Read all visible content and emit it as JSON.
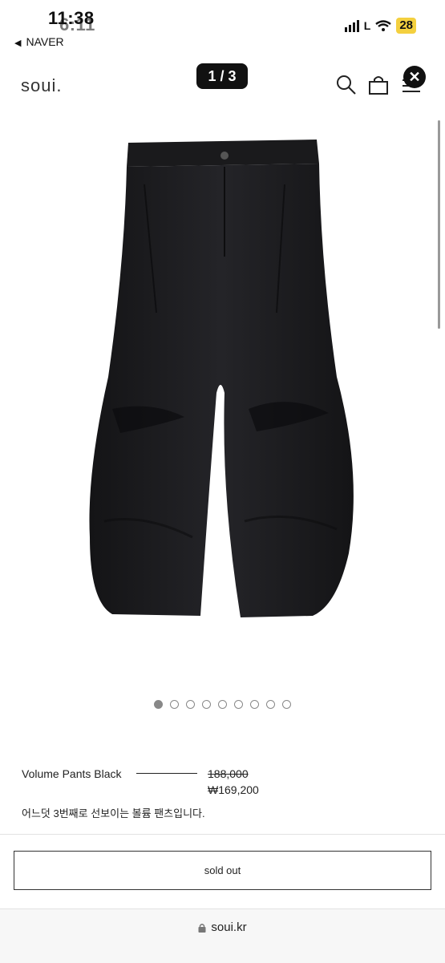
{
  "status": {
    "time": "11:38",
    "time_overlay": "6:11",
    "back_label": "NAVER",
    "carrier": "L",
    "battery": "28"
  },
  "header": {
    "logo": "soui.",
    "image_counter": "1 / 3",
    "icons": [
      "search-icon",
      "bag-icon",
      "menu-icon",
      "close-icon"
    ],
    "close_glyph": "✕"
  },
  "gallery": {
    "dot_count": 9,
    "active_index": 0
  },
  "product": {
    "name": "Volume Pants Black",
    "original_price": "188,000",
    "sale_price": "₩169,200",
    "description": "어느덧 3번째로 선보이는 볼륨 팬츠입니다."
  },
  "actions": {
    "sold_out_label": "sold out"
  },
  "browser": {
    "url": "soui.kr"
  },
  "colors": {
    "accent": "#111111",
    "battery": "#f4d03f",
    "pants": "#1c1c1e"
  }
}
